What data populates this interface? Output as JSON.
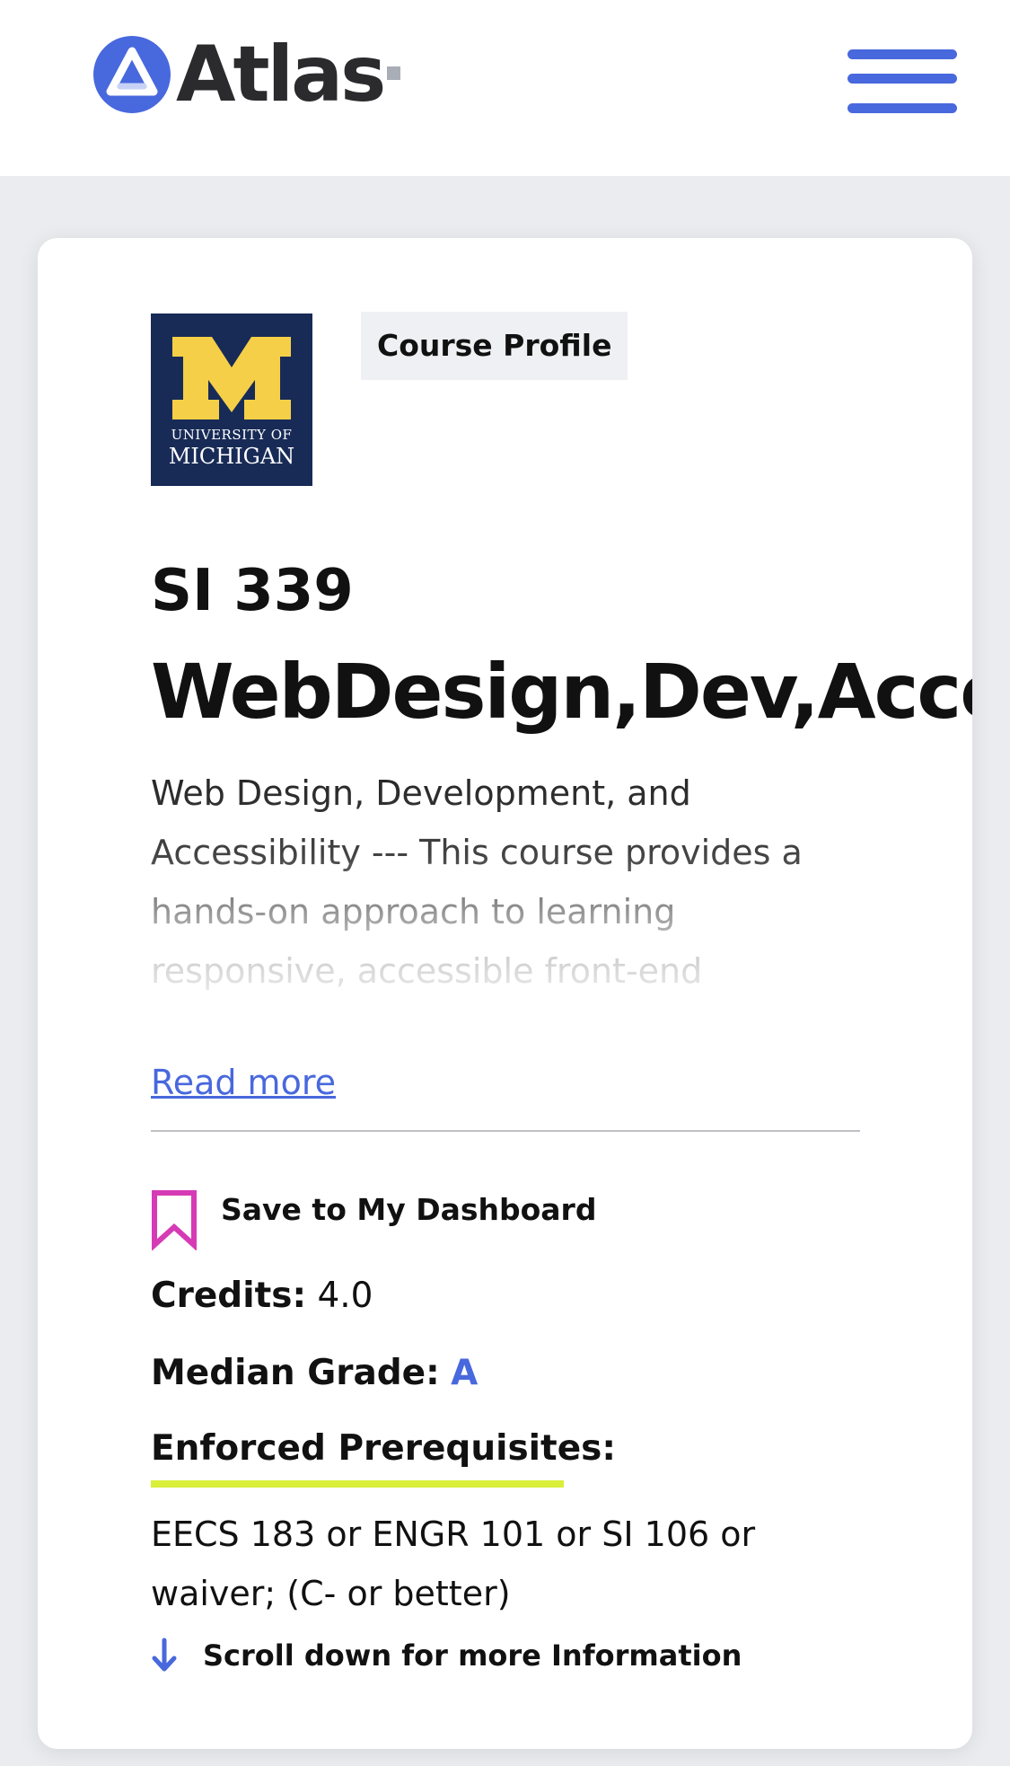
{
  "header": {
    "brand_name": "Atlas",
    "menu_icon": "hamburger-menu-icon",
    "brand_color": "#4868dd"
  },
  "card": {
    "logo": {
      "icon": "university-of-michigan-logo",
      "line1": "UNIVERSITY OF",
      "line2": "MICHIGAN"
    },
    "badge": "Course Profile",
    "course_code": "SI 339",
    "course_title": "WebDesign,Dev,Access",
    "description": "Web Design, Development, and Accessibility --- This course provides a hands-on approach to learning responsive, accessible front-end",
    "read_more": "Read more",
    "save": {
      "label": "Save to My Dashboard",
      "icon": "bookmark-icon",
      "icon_color": "#d63bb5"
    },
    "credits": {
      "label": "Credits:",
      "value": "4.0"
    },
    "median_grade": {
      "label": "Median Grade:",
      "value": "A"
    },
    "prerequisites": {
      "label": "Enforced Prerequisites:",
      "value": "EECS 183 or ENGR 101 or SI 106 or waiver; (C- or better)",
      "highlight_color": "#d9ef3a"
    },
    "scroll_hint": {
      "label": "Scroll down for more Information",
      "icon": "arrow-down-icon"
    }
  }
}
